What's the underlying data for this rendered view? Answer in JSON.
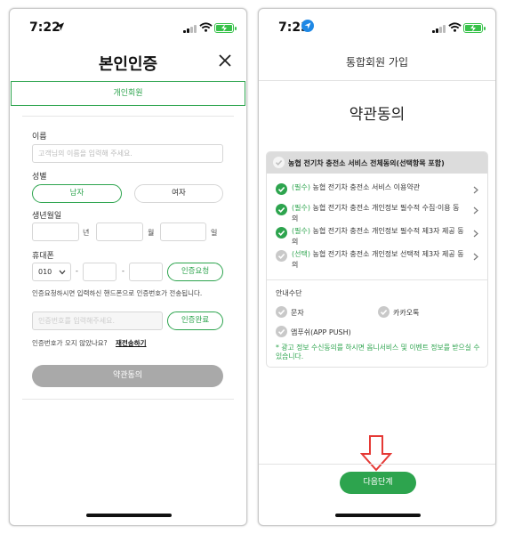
{
  "left": {
    "status": {
      "time": "7:22"
    },
    "title": "본인인증",
    "tab_label": "개인회원",
    "name": {
      "label": "이름",
      "placeholder": "고객님의 이름을 입력해 주세요."
    },
    "gender": {
      "label": "성별",
      "male": "남자",
      "female": "여자"
    },
    "birth": {
      "label": "생년월일",
      "year_unit": "년",
      "month_unit": "월",
      "day_unit": "일"
    },
    "phone": {
      "label": "휴대폰",
      "carrier": "010",
      "dash": "-",
      "request_button": "인증요청"
    },
    "notice": "인증요청하시면 입력하신 핸드폰으로 인증번호가 전송됩니다.",
    "code": {
      "placeholder": "인증번호를 입력해주세요.",
      "complete_button": "인증완료"
    },
    "resend": {
      "text": "인증번호가 오지 않았나요?",
      "link": "재전송하기"
    },
    "submit_button": "약관동의"
  },
  "right": {
    "status": {
      "time": "7:23"
    },
    "header_title": "통합회원 가입",
    "section_title": "약관동의",
    "all_agree": "농협 전기차 충전소 서비스 전체동의(선택항목 포함)",
    "terms": [
      {
        "tag": "(필수)",
        "text": "농협 전기차 충전소 서비스 이용약관",
        "checked": true
      },
      {
        "tag": "(필수)",
        "text": "농협 전기차 충전소 개인정보 필수적 수집·이용 동의",
        "checked": true
      },
      {
        "tag": "(필수)",
        "text": "농협 전기차 충전소 개인정보 필수적 제3자 제공 동의",
        "checked": true
      },
      {
        "tag": "(선택)",
        "text": "농협 전기차 충전소 개인정보 선택적 제3자 제공 동의",
        "checked": false
      }
    ],
    "notice_title": "안내수단",
    "channels": [
      "문자",
      "카카오톡",
      "앱푸쉬(APP PUSH)"
    ],
    "channel_note": "* 광고 정보 수신동의를 하시면 옵니서비스 및 이벤트 정보를 받으실 수 있습니다.",
    "next_button": "다음단계",
    "colors": {
      "accent": "#2da44e",
      "arrow": "#e53935"
    }
  }
}
